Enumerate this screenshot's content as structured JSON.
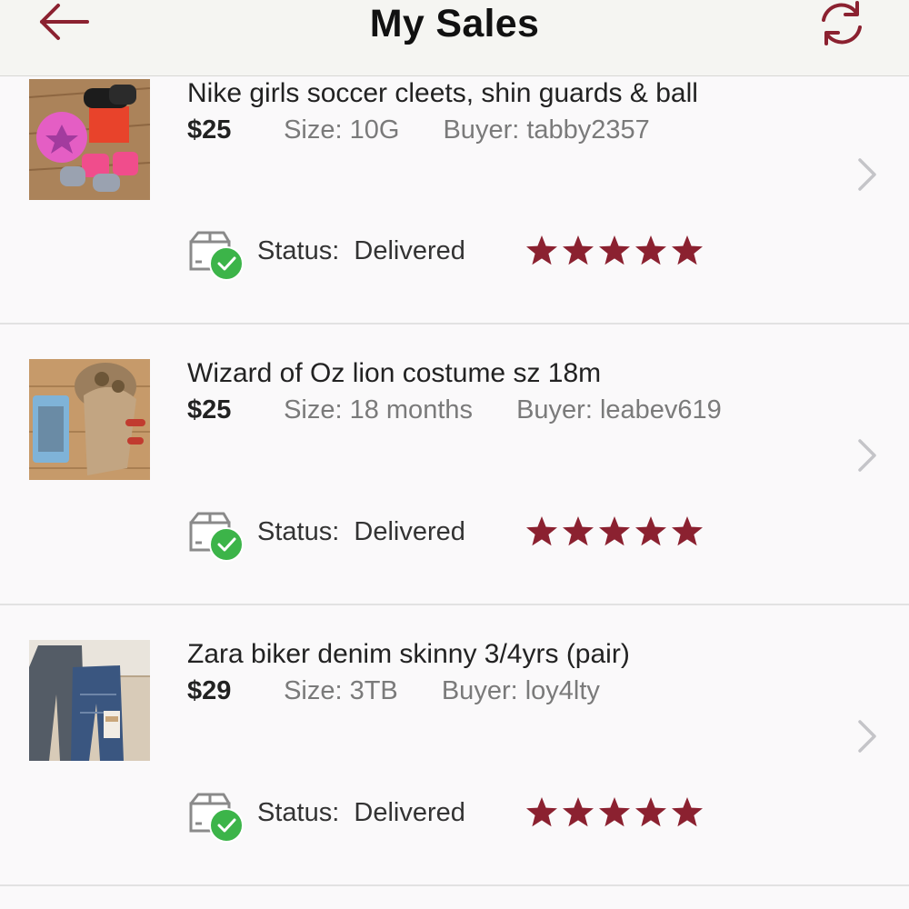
{
  "header": {
    "title": "My Sales",
    "back_icon": "back-arrow-icon",
    "refresh_icon": "refresh-icon",
    "accent_color": "#8b2130"
  },
  "sales": [
    {
      "title": "Nike girls soccer cleets, shin guards & ball",
      "price": "$25",
      "size": "Size: 10G",
      "buyer": "Buyer: tabby2357",
      "status_label": "Status:",
      "status_value": "Delivered",
      "rating": 5
    },
    {
      "title": "Wizard of Oz lion costume sz 18m",
      "price": "$25",
      "size": "Size: 18 months",
      "buyer": "Buyer: leabev619",
      "status_label": "Status:",
      "status_value": "Delivered",
      "rating": 5
    },
    {
      "title": "Zara biker denim skinny 3/4yrs (pair)",
      "price": "$29",
      "size": "Size: 3TB",
      "buyer": "Buyer: loy4lty",
      "status_label": "Status:",
      "status_value": "Delivered",
      "rating": 5
    }
  ],
  "colors": {
    "star": "#8b2130",
    "check": "#3cb449",
    "chevron": "#c4c4c8"
  }
}
